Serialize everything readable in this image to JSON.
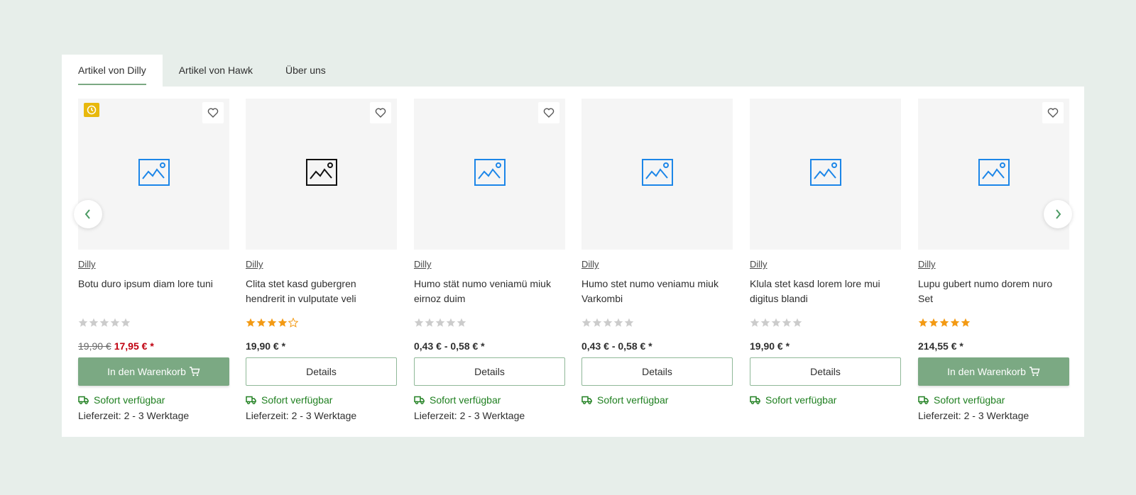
{
  "tabs": [
    {
      "label": "Artikel von Dilly",
      "active": true
    },
    {
      "label": "Artikel von Hawk",
      "active": false
    },
    {
      "label": "Über uns",
      "active": false
    }
  ],
  "colors": {
    "accent": "#7ba983",
    "available": "#208021",
    "sale": "#c0000f",
    "star": "#f39a14",
    "star_empty": "#cccccc",
    "badge": "#e8b80c"
  },
  "products": [
    {
      "manufacturer": "Dilly",
      "name": "Botu duro ipsum diam lore tuni",
      "rating": 0,
      "price_old": "19,90 €",
      "price": "17,95 € *",
      "button": "In den Warenkorb",
      "button_type": "cart",
      "availability": "Sofort verfügbar",
      "delivery": "Lieferzeit: 2 - 3 Werktage",
      "badge": "clock-icon",
      "wishlist": true,
      "image_icon": "image-placeholder-icon"
    },
    {
      "manufacturer": "Dilly",
      "name": "Clita stet kasd gubergren hendrerit in vulputate veli",
      "rating": 4,
      "price": "19,90 € *",
      "button": "Details",
      "button_type": "details",
      "availability": "Sofort verfügbar",
      "delivery": "Lieferzeit: 2 - 3 Werktage",
      "wishlist": true,
      "image_icon": "image-placeholder-icon"
    },
    {
      "manufacturer": "Dilly",
      "name": "Humo stät numo veniamü miuk eirnoz duim",
      "rating": 0,
      "price": "0,43 € - 0,58 € *",
      "button": "Details",
      "button_type": "details",
      "availability": "Sofort verfügbar",
      "delivery": "Lieferzeit: 2 - 3 Werktage",
      "wishlist": true,
      "image_icon": "image-placeholder-icon"
    },
    {
      "manufacturer": "Dilly",
      "name": "Humo stet numo veniamu miuk Varkombi",
      "rating": 0,
      "price": "0,43 € - 0,58 € *",
      "button": "Details",
      "button_type": "details",
      "availability": "Sofort verfügbar",
      "delivery": "",
      "wishlist": false,
      "image_icon": "image-placeholder-icon"
    },
    {
      "manufacturer": "Dilly",
      "name": "Klula stet kasd lorem lore mui digitus blandi",
      "rating": 0,
      "price": "19,90 € *",
      "button": "Details",
      "button_type": "details",
      "availability": "Sofort verfügbar",
      "delivery": "",
      "wishlist": false,
      "image_icon": "image-placeholder-icon"
    },
    {
      "manufacturer": "Dilly",
      "name": "Lupu gubert numo dorem nuro Set",
      "rating": 5,
      "price": "214,55 € *",
      "button": "In den Warenkorb",
      "button_type": "cart",
      "availability": "Sofort verfügbar",
      "delivery": "Lieferzeit: 2 - 3 Werktage",
      "wishlist": true,
      "image_icon": "image-placeholder-icon"
    }
  ],
  "slider": {
    "prev_icon": "chevron-left-icon",
    "next_icon": "chevron-right-icon"
  }
}
